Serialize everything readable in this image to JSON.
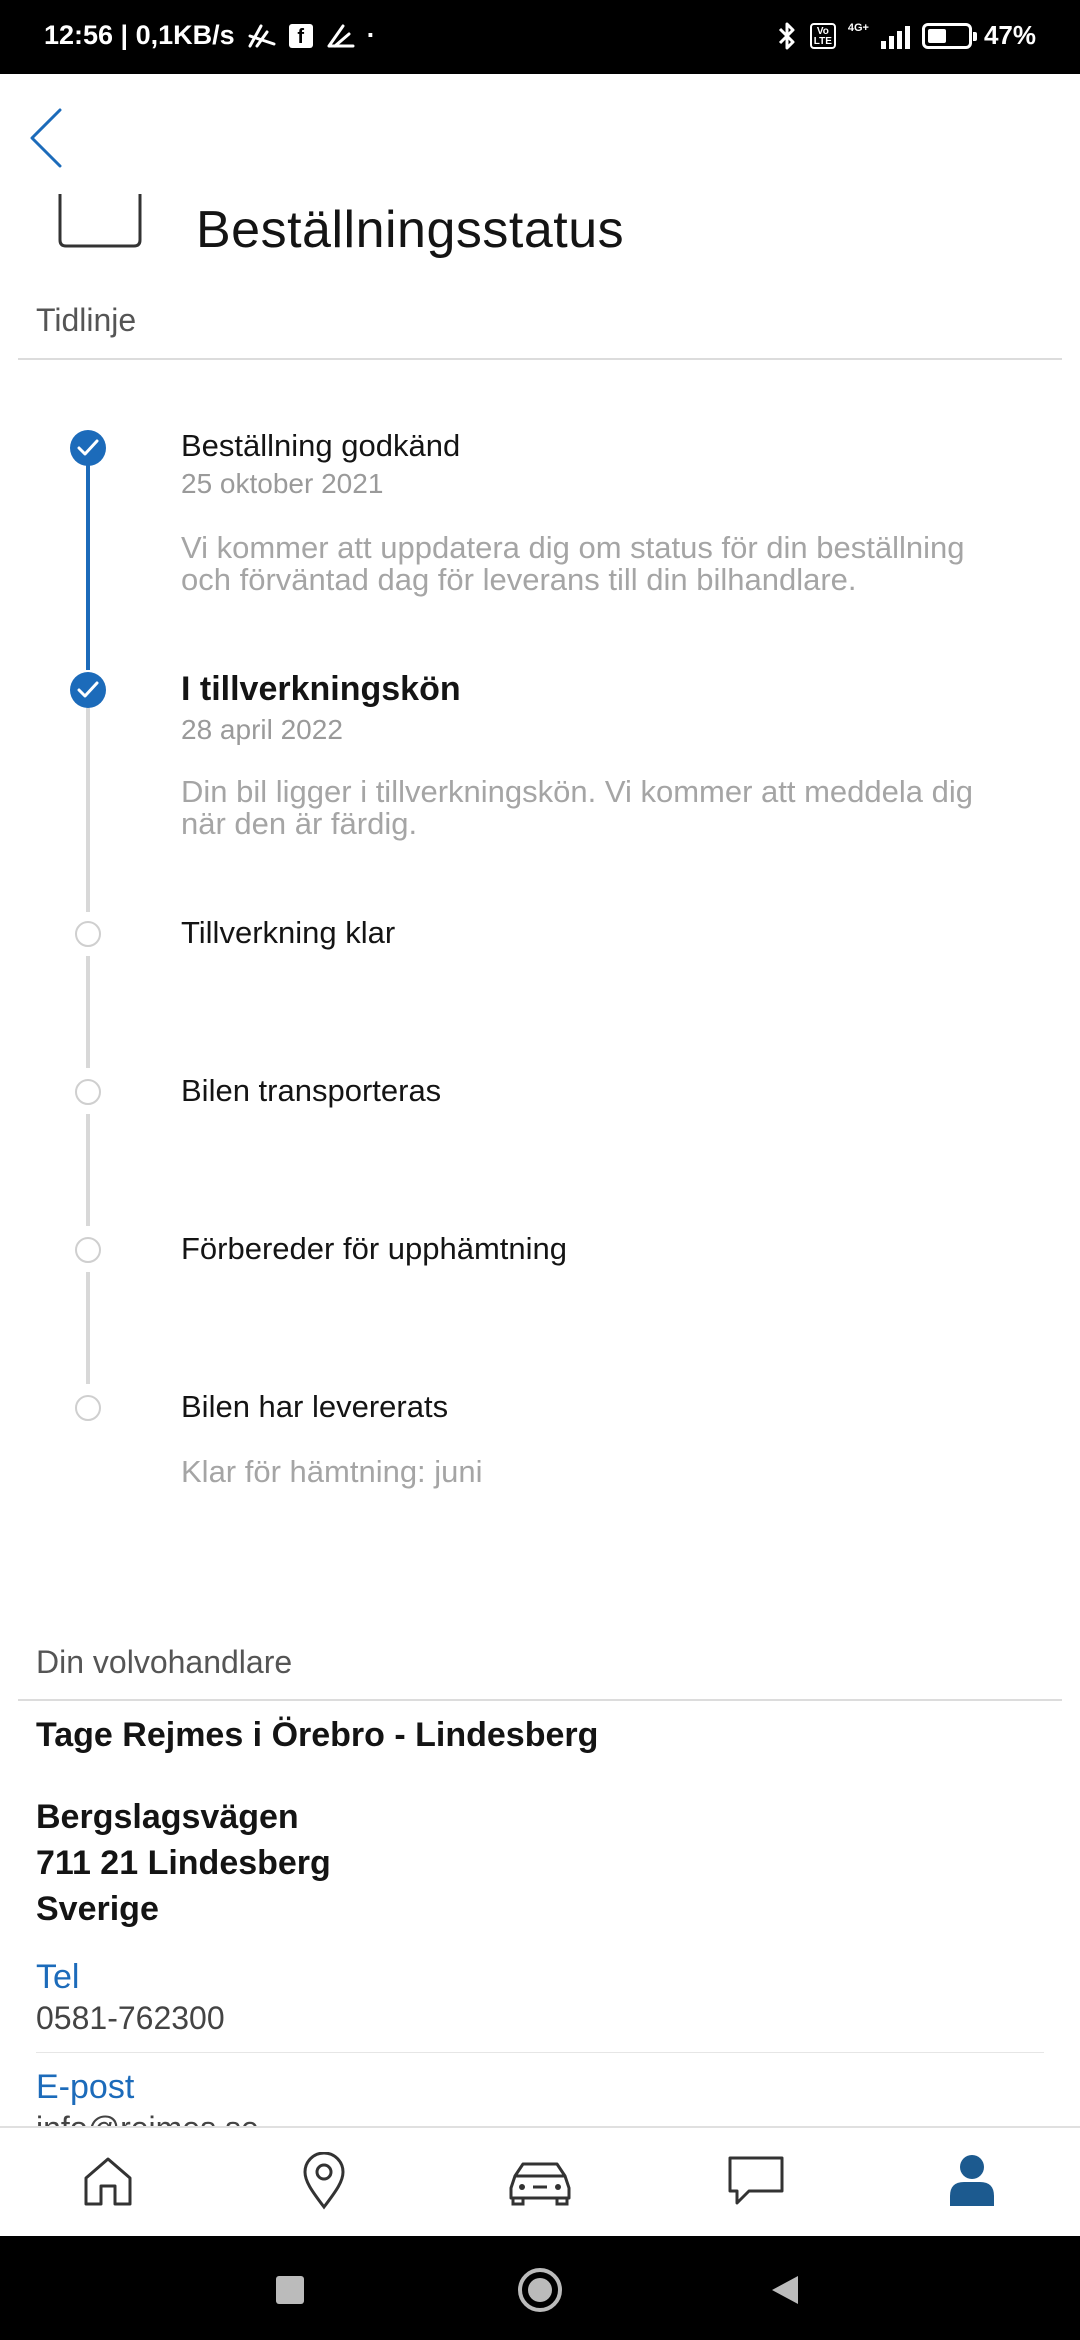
{
  "status_bar": {
    "time_speed": "12:56 | 0,1KB/s",
    "fb": "f",
    "dot": "·",
    "network": "4G+",
    "volte": "Vo LTE",
    "battery_text": "47%",
    "battery_level": 0.47
  },
  "header": {
    "title": "Beställningsstatus",
    "back_icon": "chevron-left-icon"
  },
  "timeline": {
    "label": "Tidlinje",
    "steps": [
      {
        "title": "Beställning godkänd",
        "date": "25 oktober 2021",
        "description": "Vi kommer att uppdatera dig om status för din beställning och förväntad dag för leverans till din bilhandlare.",
        "state": "done"
      },
      {
        "title": "I tillverkningskön",
        "date": "28 april 2022",
        "description": "Din bil ligger i tillverkningskön. Vi kommer att meddela dig när den är färdig.",
        "state": "current"
      },
      {
        "title": "Tillverkning klar",
        "state": "pending"
      },
      {
        "title": "Bilen transporteras",
        "state": "pending"
      },
      {
        "title": "Förbereder för upphämtning",
        "state": "pending"
      },
      {
        "title": "Bilen har levererats",
        "note": "Klar för hämtning: juni",
        "state": "pending"
      }
    ]
  },
  "dealer": {
    "label": "Din volvohandlare",
    "name": "Tage Rejmes i Örebro - Lindesberg",
    "address_line1": "Bergslagsvägen",
    "address_line2": "711 21 Lindesberg",
    "address_line3": "Sverige",
    "tel_label": "Tel",
    "tel_value": "0581-762300",
    "email_label": "E-post",
    "email_value": "info@rejmes.se"
  },
  "bottom_nav": {
    "items": [
      "home-icon",
      "location-pin-icon",
      "car-icon",
      "chat-icon",
      "profile-icon"
    ],
    "active": "profile-icon"
  },
  "colors": {
    "accent": "#1c6bba",
    "text": "#141414",
    "muted": "#a5a5a5"
  }
}
